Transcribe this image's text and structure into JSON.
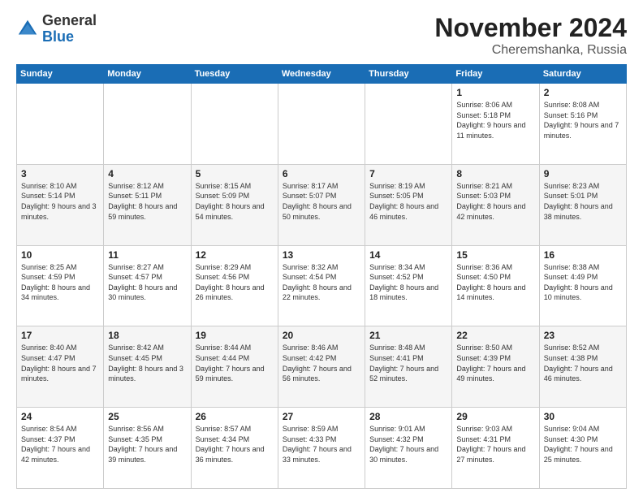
{
  "logo": {
    "line1": "General",
    "line2": "Blue"
  },
  "title": "November 2024",
  "subtitle": "Cheremshanka, Russia",
  "weekdays": [
    "Sunday",
    "Monday",
    "Tuesday",
    "Wednesday",
    "Thursday",
    "Friday",
    "Saturday"
  ],
  "weeks": [
    [
      {
        "day": "",
        "info": ""
      },
      {
        "day": "",
        "info": ""
      },
      {
        "day": "",
        "info": ""
      },
      {
        "day": "",
        "info": ""
      },
      {
        "day": "",
        "info": ""
      },
      {
        "day": "1",
        "info": "Sunrise: 8:06 AM\nSunset: 5:18 PM\nDaylight: 9 hours and 11 minutes."
      },
      {
        "day": "2",
        "info": "Sunrise: 8:08 AM\nSunset: 5:16 PM\nDaylight: 9 hours and 7 minutes."
      }
    ],
    [
      {
        "day": "3",
        "info": "Sunrise: 8:10 AM\nSunset: 5:14 PM\nDaylight: 9 hours and 3 minutes."
      },
      {
        "day": "4",
        "info": "Sunrise: 8:12 AM\nSunset: 5:11 PM\nDaylight: 8 hours and 59 minutes."
      },
      {
        "day": "5",
        "info": "Sunrise: 8:15 AM\nSunset: 5:09 PM\nDaylight: 8 hours and 54 minutes."
      },
      {
        "day": "6",
        "info": "Sunrise: 8:17 AM\nSunset: 5:07 PM\nDaylight: 8 hours and 50 minutes."
      },
      {
        "day": "7",
        "info": "Sunrise: 8:19 AM\nSunset: 5:05 PM\nDaylight: 8 hours and 46 minutes."
      },
      {
        "day": "8",
        "info": "Sunrise: 8:21 AM\nSunset: 5:03 PM\nDaylight: 8 hours and 42 minutes."
      },
      {
        "day": "9",
        "info": "Sunrise: 8:23 AM\nSunset: 5:01 PM\nDaylight: 8 hours and 38 minutes."
      }
    ],
    [
      {
        "day": "10",
        "info": "Sunrise: 8:25 AM\nSunset: 4:59 PM\nDaylight: 8 hours and 34 minutes."
      },
      {
        "day": "11",
        "info": "Sunrise: 8:27 AM\nSunset: 4:57 PM\nDaylight: 8 hours and 30 minutes."
      },
      {
        "day": "12",
        "info": "Sunrise: 8:29 AM\nSunset: 4:56 PM\nDaylight: 8 hours and 26 minutes."
      },
      {
        "day": "13",
        "info": "Sunrise: 8:32 AM\nSunset: 4:54 PM\nDaylight: 8 hours and 22 minutes."
      },
      {
        "day": "14",
        "info": "Sunrise: 8:34 AM\nSunset: 4:52 PM\nDaylight: 8 hours and 18 minutes."
      },
      {
        "day": "15",
        "info": "Sunrise: 8:36 AM\nSunset: 4:50 PM\nDaylight: 8 hours and 14 minutes."
      },
      {
        "day": "16",
        "info": "Sunrise: 8:38 AM\nSunset: 4:49 PM\nDaylight: 8 hours and 10 minutes."
      }
    ],
    [
      {
        "day": "17",
        "info": "Sunrise: 8:40 AM\nSunset: 4:47 PM\nDaylight: 8 hours and 7 minutes."
      },
      {
        "day": "18",
        "info": "Sunrise: 8:42 AM\nSunset: 4:45 PM\nDaylight: 8 hours and 3 minutes."
      },
      {
        "day": "19",
        "info": "Sunrise: 8:44 AM\nSunset: 4:44 PM\nDaylight: 7 hours and 59 minutes."
      },
      {
        "day": "20",
        "info": "Sunrise: 8:46 AM\nSunset: 4:42 PM\nDaylight: 7 hours and 56 minutes."
      },
      {
        "day": "21",
        "info": "Sunrise: 8:48 AM\nSunset: 4:41 PM\nDaylight: 7 hours and 52 minutes."
      },
      {
        "day": "22",
        "info": "Sunrise: 8:50 AM\nSunset: 4:39 PM\nDaylight: 7 hours and 49 minutes."
      },
      {
        "day": "23",
        "info": "Sunrise: 8:52 AM\nSunset: 4:38 PM\nDaylight: 7 hours and 46 minutes."
      }
    ],
    [
      {
        "day": "24",
        "info": "Sunrise: 8:54 AM\nSunset: 4:37 PM\nDaylight: 7 hours and 42 minutes."
      },
      {
        "day": "25",
        "info": "Sunrise: 8:56 AM\nSunset: 4:35 PM\nDaylight: 7 hours and 39 minutes."
      },
      {
        "day": "26",
        "info": "Sunrise: 8:57 AM\nSunset: 4:34 PM\nDaylight: 7 hours and 36 minutes."
      },
      {
        "day": "27",
        "info": "Sunrise: 8:59 AM\nSunset: 4:33 PM\nDaylight: 7 hours and 33 minutes."
      },
      {
        "day": "28",
        "info": "Sunrise: 9:01 AM\nSunset: 4:32 PM\nDaylight: 7 hours and 30 minutes."
      },
      {
        "day": "29",
        "info": "Sunrise: 9:03 AM\nSunset: 4:31 PM\nDaylight: 7 hours and 27 minutes."
      },
      {
        "day": "30",
        "info": "Sunrise: 9:04 AM\nSunset: 4:30 PM\nDaylight: 7 hours and 25 minutes."
      }
    ]
  ]
}
